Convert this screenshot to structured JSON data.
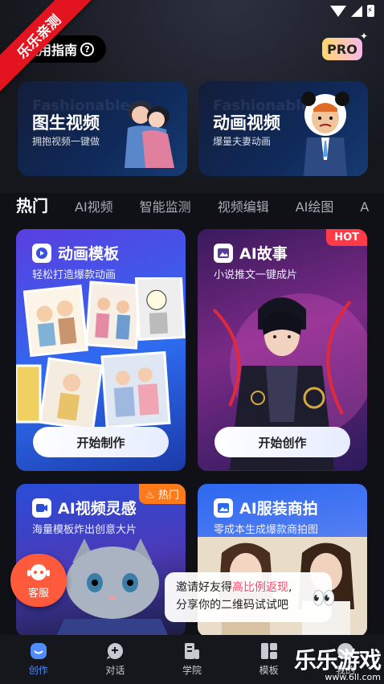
{
  "ribbon": "乐乐亲测",
  "header": {
    "guide_label": "使用指南",
    "pro_label": "PRO"
  },
  "features": [
    {
      "watermark": "Fashionable",
      "title": "图生视频",
      "subtitle": "拥抱视频一键做"
    },
    {
      "watermark": "Fashionable",
      "title": "动画视频",
      "subtitle": "爆量夫妻动画"
    }
  ],
  "tabs": [
    "热门",
    "AI视频",
    "智能监测",
    "视频编辑",
    "AI绘图",
    "A"
  ],
  "cards": [
    {
      "title": "动画模板",
      "subtitle": "轻松打造爆款动画",
      "cta": "开始制作",
      "badge": ""
    },
    {
      "title": "AI故事",
      "subtitle": "小说推文一键成片",
      "cta": "开始创作",
      "badge": "HOT"
    },
    {
      "title": "AI视频灵感",
      "subtitle": "海量模板炸出创意大片",
      "cta": "",
      "badge": "热门"
    },
    {
      "title": "AI服装商拍",
      "subtitle": "零成本生成爆款商拍图",
      "cta": "",
      "badge": ""
    }
  ],
  "kefu_label": "客服",
  "invite": {
    "line1_a": "邀请好友得",
    "line1_b": "高比例返现",
    "line1_c": ",",
    "line2": "分享你的二维码试试吧"
  },
  "nav": [
    "创作",
    "对话",
    "学院",
    "模板",
    "我的"
  ],
  "watermark": {
    "big": "乐乐游戏",
    "small": "www.6ll.com"
  },
  "colors": {
    "accent": "#4f8dff",
    "ribbon": "#e3141f",
    "hot": "#ff3b48"
  }
}
